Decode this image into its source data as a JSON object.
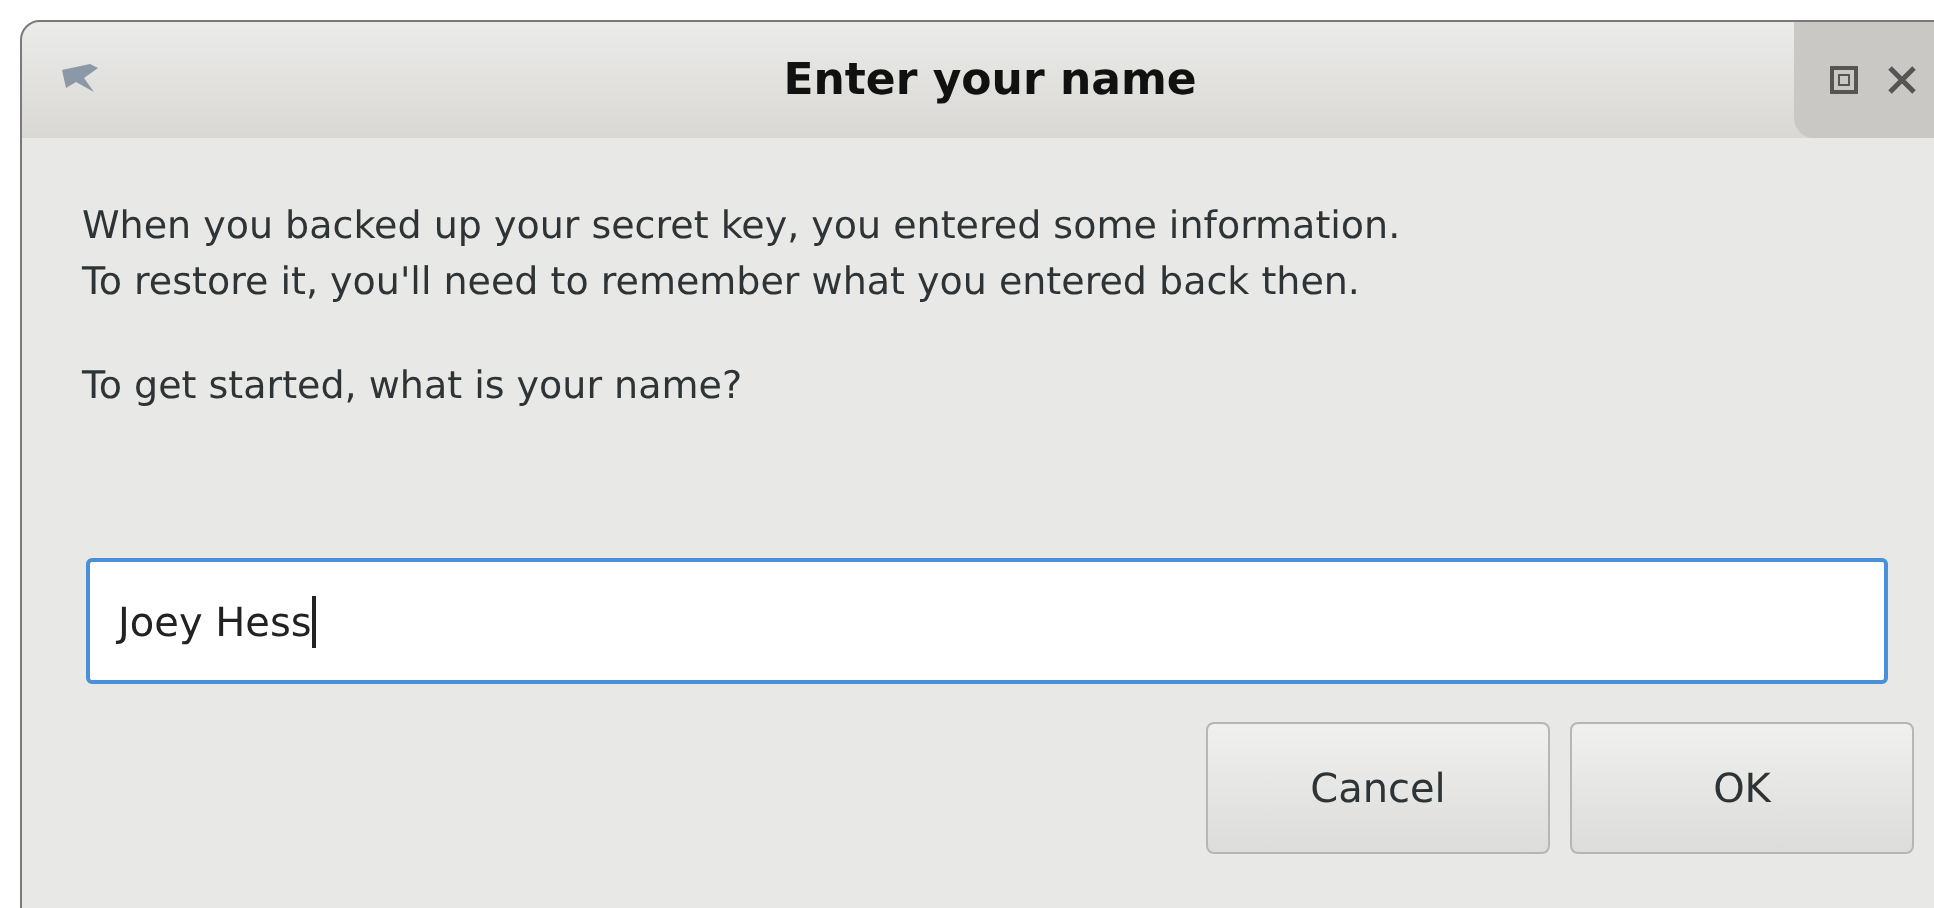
{
  "window": {
    "title": "Enter your name"
  },
  "message": [
    "When you backed up your secret key, you entered some information.",
    "To restore it, you'll need to remember what you entered back then."
  ],
  "prompt": "To get started, what is your name?",
  "name_field": {
    "value": "Joey Hess",
    "focused": true
  },
  "buttons": [
    {
      "label": "Cancel"
    },
    {
      "label": "OK"
    }
  ]
}
